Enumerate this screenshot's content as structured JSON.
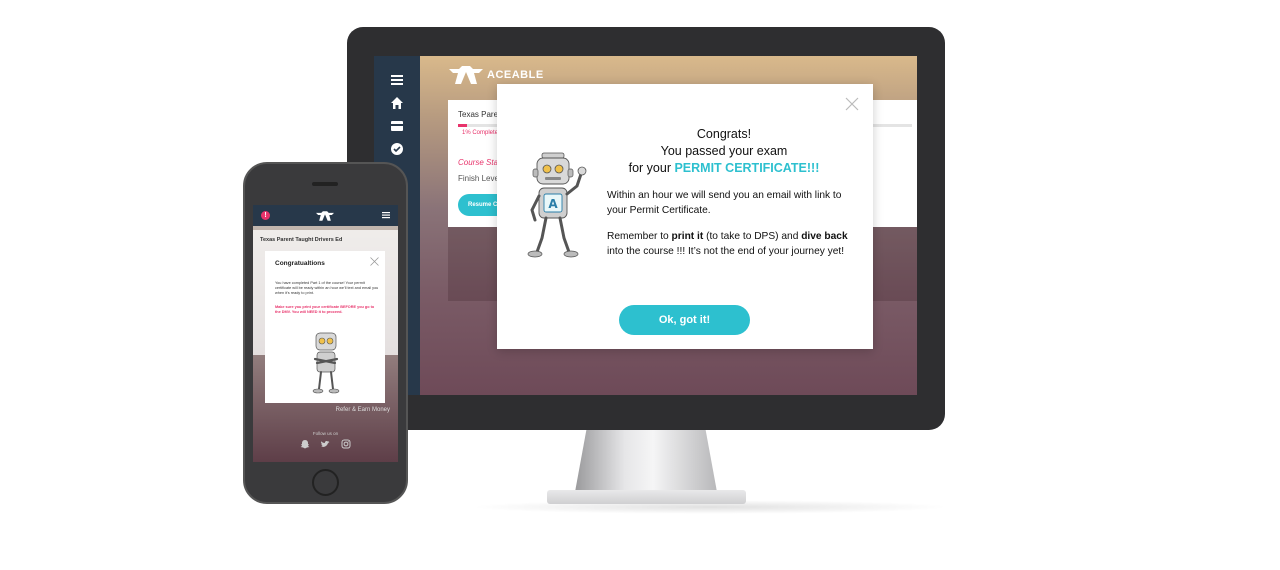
{
  "colors": {
    "accent": "#2dc0cf",
    "nav": "#27384a",
    "pink": "#e8336b"
  },
  "desktop": {
    "brand": "ACEABLE",
    "nav_icons": [
      "menu-icon",
      "home-icon",
      "card-icon",
      "check-circle-icon"
    ],
    "course_card": {
      "title": "Texas Parer",
      "progress_value": 1,
      "progress_label": "1% Complete",
      "status": "Course Sta",
      "finish": "Finish Level",
      "resume": "Resume Co"
    },
    "modal": {
      "line1": "Congrats!",
      "line2": "You passed your exam",
      "line3_prefix": "for your ",
      "line3_accent": "PERMIT CERTIFICATE!!!",
      "para1": "Within an hour we will send you an email with link to your Permit Certificate.",
      "para2_a": "Remember to ",
      "para2_b": "print it",
      "para2_c": " (to take to DPS) and ",
      "para2_d": "dive back",
      "para2_e": " into the course !!! It’s not the end of your journey yet!",
      "button": "Ok, got it!"
    }
  },
  "phone": {
    "course_title": "Texas Parent Taught Drivers Ed",
    "modal": {
      "title": "Congratualtions",
      "body": "You have completed Part 1 of the course! Your permit certificate will be ready within an hour we'll text and email you when it's ready to print.",
      "warning": "Make sure you print your certificate BEFORE you go to the DMV. You will NEED it to proceed."
    },
    "footer_link": "Refer & Earn Money",
    "follow_label": "Follow us on",
    "social_icons": [
      "snapchat-icon",
      "twitter-icon",
      "instagram-icon"
    ]
  }
}
